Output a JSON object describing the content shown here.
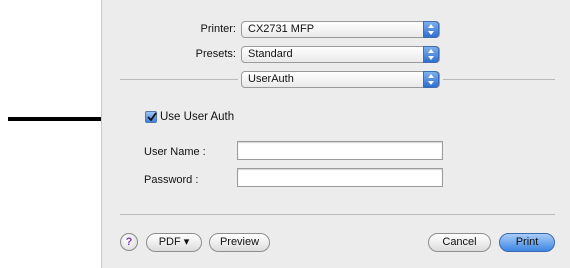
{
  "printer": {
    "label": "Printer:",
    "value": "CX2731 MFP"
  },
  "presets": {
    "label": "Presets:",
    "value": "Standard"
  },
  "panel": {
    "value": "UserAuth"
  },
  "auth": {
    "checkbox_label": "Use User Auth",
    "checked": true,
    "username_label": "User Name :",
    "username_value": "",
    "password_label": "Password :",
    "password_value": ""
  },
  "footer": {
    "help_symbol": "?",
    "pdf_label": "PDF ▾",
    "preview_label": "Preview",
    "cancel_label": "Cancel",
    "print_label": "Print"
  },
  "colors": {
    "accent": "#3d86e3",
    "dialog_bg": "#ececec"
  }
}
